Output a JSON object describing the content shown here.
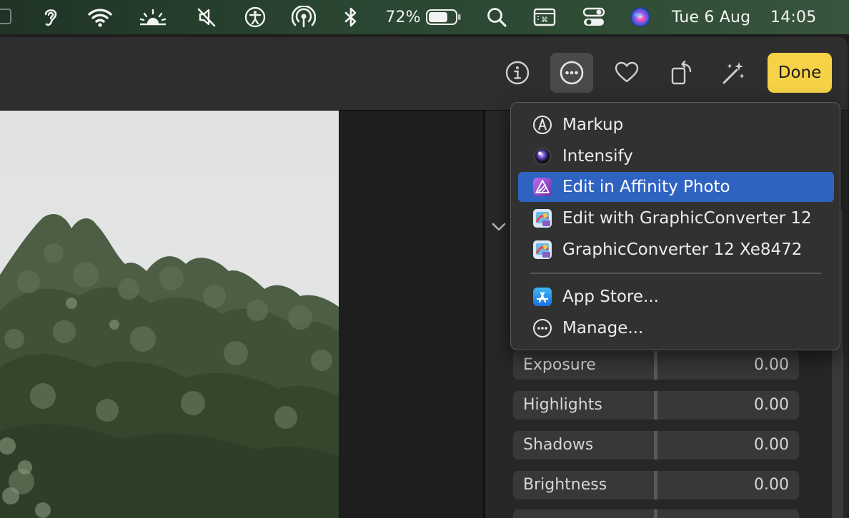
{
  "menubar": {
    "battery_percent": "72%",
    "battery_level": 0.72,
    "date": "Tue 6 Aug",
    "time": "14:05",
    "icons": [
      "hearing-icon",
      "wifi-icon",
      "display-brightness-icon",
      "muted-speaker-icon",
      "accessibility-icon",
      "airdrop-icon",
      "bluetooth-icon",
      "battery-icon",
      "search-icon",
      "keyboard-viewer-icon",
      "control-center-icon",
      "siri-icon"
    ]
  },
  "toolbar": {
    "icons": [
      "info-icon",
      "more-options-icon",
      "favorite-heart-icon",
      "rotate-icon",
      "auto-enhance-icon"
    ],
    "done_label": "Done",
    "accent_color": "#f6d246"
  },
  "menu": {
    "items": [
      {
        "label": "Markup",
        "icon": "markup-pen-icon"
      },
      {
        "label": "Intensify",
        "icon": "intensify-app-icon"
      },
      {
        "label": "Edit in Affinity Photo",
        "icon": "affinity-photo-icon",
        "highlighted": true
      },
      {
        "label": "Edit with GraphicConverter 12",
        "icon": "graphicconverter-icon"
      },
      {
        "label": "GraphicConverter 12 Xe8472",
        "icon": "graphicconverter-icon"
      },
      {
        "label": "App Store...",
        "icon": "app-store-icon"
      },
      {
        "label": "Manage...",
        "icon": "more-circle-icon"
      }
    ],
    "highlight_color": "#2f63c2"
  },
  "adjustments": [
    {
      "label": "Exposure",
      "value": "0.00"
    },
    {
      "label": "Highlights",
      "value": "0.00"
    },
    {
      "label": "Shadows",
      "value": "0.00"
    },
    {
      "label": "Brightness",
      "value": "0.00"
    }
  ]
}
